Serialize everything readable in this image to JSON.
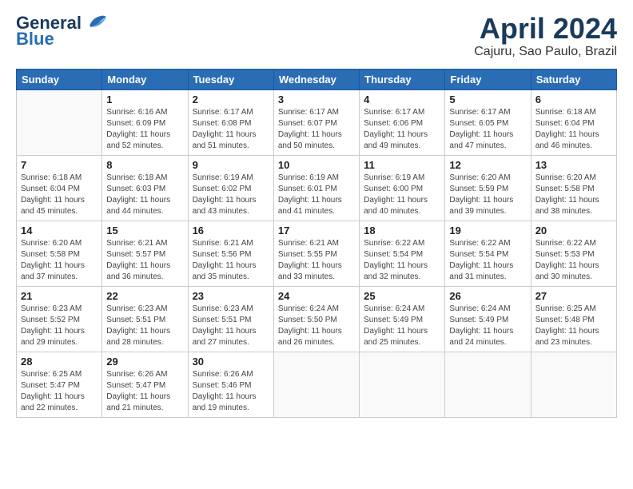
{
  "header": {
    "logo_line1": "General",
    "logo_line2": "Blue",
    "month": "April 2024",
    "location": "Cajuru, Sao Paulo, Brazil"
  },
  "weekdays": [
    "Sunday",
    "Monday",
    "Tuesday",
    "Wednesday",
    "Thursday",
    "Friday",
    "Saturday"
  ],
  "weeks": [
    [
      {
        "day": "",
        "info": ""
      },
      {
        "day": "1",
        "info": "Sunrise: 6:16 AM\nSunset: 6:09 PM\nDaylight: 11 hours\nand 52 minutes."
      },
      {
        "day": "2",
        "info": "Sunrise: 6:17 AM\nSunset: 6:08 PM\nDaylight: 11 hours\nand 51 minutes."
      },
      {
        "day": "3",
        "info": "Sunrise: 6:17 AM\nSunset: 6:07 PM\nDaylight: 11 hours\nand 50 minutes."
      },
      {
        "day": "4",
        "info": "Sunrise: 6:17 AM\nSunset: 6:06 PM\nDaylight: 11 hours\nand 49 minutes."
      },
      {
        "day": "5",
        "info": "Sunrise: 6:17 AM\nSunset: 6:05 PM\nDaylight: 11 hours\nand 47 minutes."
      },
      {
        "day": "6",
        "info": "Sunrise: 6:18 AM\nSunset: 6:04 PM\nDaylight: 11 hours\nand 46 minutes."
      }
    ],
    [
      {
        "day": "7",
        "info": "Sunrise: 6:18 AM\nSunset: 6:04 PM\nDaylight: 11 hours\nand 45 minutes."
      },
      {
        "day": "8",
        "info": "Sunrise: 6:18 AM\nSunset: 6:03 PM\nDaylight: 11 hours\nand 44 minutes."
      },
      {
        "day": "9",
        "info": "Sunrise: 6:19 AM\nSunset: 6:02 PM\nDaylight: 11 hours\nand 43 minutes."
      },
      {
        "day": "10",
        "info": "Sunrise: 6:19 AM\nSunset: 6:01 PM\nDaylight: 11 hours\nand 41 minutes."
      },
      {
        "day": "11",
        "info": "Sunrise: 6:19 AM\nSunset: 6:00 PM\nDaylight: 11 hours\nand 40 minutes."
      },
      {
        "day": "12",
        "info": "Sunrise: 6:20 AM\nSunset: 5:59 PM\nDaylight: 11 hours\nand 39 minutes."
      },
      {
        "day": "13",
        "info": "Sunrise: 6:20 AM\nSunset: 5:58 PM\nDaylight: 11 hours\nand 38 minutes."
      }
    ],
    [
      {
        "day": "14",
        "info": "Sunrise: 6:20 AM\nSunset: 5:58 PM\nDaylight: 11 hours\nand 37 minutes."
      },
      {
        "day": "15",
        "info": "Sunrise: 6:21 AM\nSunset: 5:57 PM\nDaylight: 11 hours\nand 36 minutes."
      },
      {
        "day": "16",
        "info": "Sunrise: 6:21 AM\nSunset: 5:56 PM\nDaylight: 11 hours\nand 35 minutes."
      },
      {
        "day": "17",
        "info": "Sunrise: 6:21 AM\nSunset: 5:55 PM\nDaylight: 11 hours\nand 33 minutes."
      },
      {
        "day": "18",
        "info": "Sunrise: 6:22 AM\nSunset: 5:54 PM\nDaylight: 11 hours\nand 32 minutes."
      },
      {
        "day": "19",
        "info": "Sunrise: 6:22 AM\nSunset: 5:54 PM\nDaylight: 11 hours\nand 31 minutes."
      },
      {
        "day": "20",
        "info": "Sunrise: 6:22 AM\nSunset: 5:53 PM\nDaylight: 11 hours\nand 30 minutes."
      }
    ],
    [
      {
        "day": "21",
        "info": "Sunrise: 6:23 AM\nSunset: 5:52 PM\nDaylight: 11 hours\nand 29 minutes."
      },
      {
        "day": "22",
        "info": "Sunrise: 6:23 AM\nSunset: 5:51 PM\nDaylight: 11 hours\nand 28 minutes."
      },
      {
        "day": "23",
        "info": "Sunrise: 6:23 AM\nSunset: 5:51 PM\nDaylight: 11 hours\nand 27 minutes."
      },
      {
        "day": "24",
        "info": "Sunrise: 6:24 AM\nSunset: 5:50 PM\nDaylight: 11 hours\nand 26 minutes."
      },
      {
        "day": "25",
        "info": "Sunrise: 6:24 AM\nSunset: 5:49 PM\nDaylight: 11 hours\nand 25 minutes."
      },
      {
        "day": "26",
        "info": "Sunrise: 6:24 AM\nSunset: 5:49 PM\nDaylight: 11 hours\nand 24 minutes."
      },
      {
        "day": "27",
        "info": "Sunrise: 6:25 AM\nSunset: 5:48 PM\nDaylight: 11 hours\nand 23 minutes."
      }
    ],
    [
      {
        "day": "28",
        "info": "Sunrise: 6:25 AM\nSunset: 5:47 PM\nDaylight: 11 hours\nand 22 minutes."
      },
      {
        "day": "29",
        "info": "Sunrise: 6:26 AM\nSunset: 5:47 PM\nDaylight: 11 hours\nand 21 minutes."
      },
      {
        "day": "30",
        "info": "Sunrise: 6:26 AM\nSunset: 5:46 PM\nDaylight: 11 hours\nand 19 minutes."
      },
      {
        "day": "",
        "info": ""
      },
      {
        "day": "",
        "info": ""
      },
      {
        "day": "",
        "info": ""
      },
      {
        "day": "",
        "info": ""
      }
    ]
  ]
}
